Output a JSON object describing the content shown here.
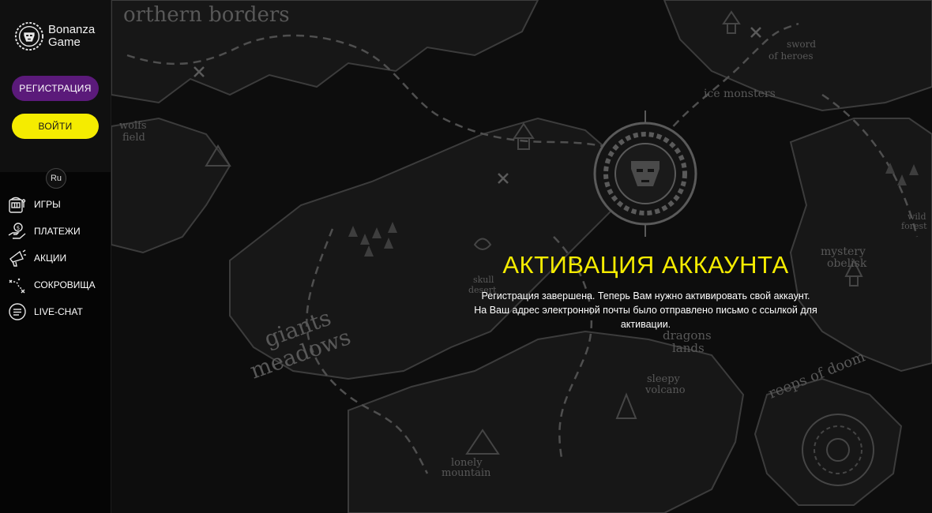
{
  "brand": {
    "name_line1": "Bonanza",
    "name_line2": "Game"
  },
  "auth": {
    "register_label": "РЕГИСТРАЦИЯ",
    "login_label": "ВОЙТИ"
  },
  "language": {
    "current": "Ru"
  },
  "menu": {
    "items": [
      {
        "label": "ИГРЫ",
        "icon": "slot-machine-icon"
      },
      {
        "label": "ПЛАТЕЖИ",
        "icon": "payment-hand-icon"
      },
      {
        "label": "АКЦИИ",
        "icon": "megaphone-icon"
      },
      {
        "label": "СОКРОВИЩА",
        "icon": "treasure-map-icon"
      },
      {
        "label": "LIVE-CHAT",
        "icon": "chat-icon"
      }
    ]
  },
  "map_labels": {
    "northern_borders": "orthern borders",
    "sword_of_heroes_1": "sword",
    "sword_of_heroes_2": "of heroes",
    "ice_monsters": "ice monsters",
    "wolfs_field_1": "wolfs",
    "wolfs_field_2": "field",
    "skull_desert_1": "skull",
    "skull_desert_2": "desert",
    "giants_meadows_1": "giants",
    "giants_meadows_2": "meadows",
    "dragons_lands_1": "dragons",
    "dragons_lands_2": "lands",
    "sleepy_volcano_1": "sleepy",
    "sleepy_volcano_2": "volcano",
    "mystery_obelisk_1": "mystery",
    "mystery_obelisk_2": "obelisk",
    "wild_forest_1": "wild",
    "wild_forest_2": "forest",
    "reeps_of_doom": "reeps of doom",
    "lonely_mountain_1": "lonely",
    "lonely_mountain_2": "mountain"
  },
  "activation": {
    "title": "АКТИВАЦИЯ АККАУНТА",
    "line1": "Регистрация завершена. Теперь Вам нужно активировать свой аккаунт.",
    "line2": "На Ваш адрес электронной почты было отправлено письмо с ссылкой для активации."
  },
  "colors": {
    "accent_yellow": "#f5ec00",
    "register_purple": "#5b1a7a",
    "background": "#0b0b0b",
    "map_lines": "#4a4a4a"
  }
}
